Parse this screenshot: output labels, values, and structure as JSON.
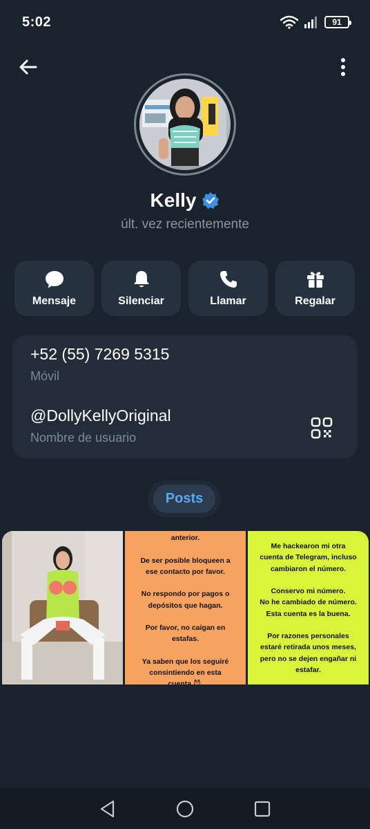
{
  "status_bar": {
    "time": "5:02",
    "battery": "91"
  },
  "profile": {
    "name": "Kelly",
    "last_seen": "últ. vez recientemente"
  },
  "actions": [
    {
      "label": "Mensaje",
      "icon": "message-icon"
    },
    {
      "label": "Silenciar",
      "icon": "bell-icon"
    },
    {
      "label": "Llamar",
      "icon": "phone-icon"
    },
    {
      "label": "Regalar",
      "icon": "gift-icon"
    }
  ],
  "info": {
    "phone": "+52 (55) 7269 5315",
    "phone_label": "Móvil",
    "username": "@DollyKellyOriginal",
    "username_label": "Nombre de usuario"
  },
  "tabs": {
    "posts": "Posts"
  },
  "posts": [
    {
      "text": ""
    },
    {
      "text": "anterior.\n\nDe ser posible bloqueen a\nese contacto por favor.\n\nNo respondo por pagos o\ndepósitos que hagan.\n\nPor favor, no caigan en\nestafas.\n\nYa saben que los seguiré\nconsintiendo en esta\ncuenta 😈."
    },
    {
      "text": "Me hackearon mi otra\ncuenta de Telegram, incluso\ncambiaron el número.\n\nConservo mi número.\nNo he cambiado de número.\nEsta cuenta es la buena.\n\nPor razones personales\nestaré retirada unos meses,\npero no se dejen engañar ni\nestafar.\n\nGracias a tod@s por su"
    }
  ],
  "colors": {
    "background": "#1a222d",
    "card": "#232d3a",
    "accent": "#5aa9ec",
    "verified": "#3d8fe0",
    "post_orange": "#f7a35f",
    "post_lime": "#d9f53a"
  }
}
